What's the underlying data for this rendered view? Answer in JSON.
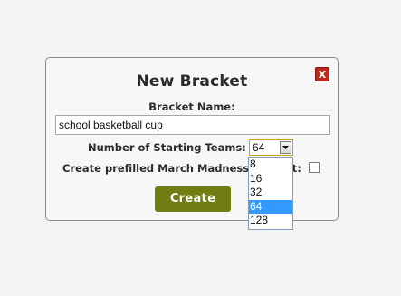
{
  "dialog": {
    "title": "New Bracket",
    "close_label": "X",
    "bracket_name_label": "Bracket Name:",
    "bracket_name_value": "school basketball cup",
    "starting_teams_label": "Number of Starting Teams:",
    "starting_teams_selected": "64",
    "prefill_label": "Create prefilled March Madness bracket:",
    "prefill_checked": false,
    "create_label": "Create"
  },
  "dropdown": {
    "options": [
      "8",
      "16",
      "32",
      "64",
      "128"
    ],
    "selected_index": 3
  },
  "colors": {
    "close_button": "#c0281c",
    "create_button": "#6f7d13",
    "option_highlight": "#3399ff"
  }
}
